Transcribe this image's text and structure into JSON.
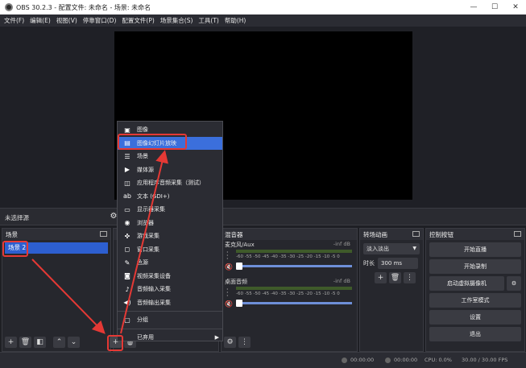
{
  "window": {
    "title": "OBS 30.2.3 - 配置文件: 未命名 - 场景: 未命名",
    "minimize": "—",
    "maximize": "☐",
    "close": "✕"
  },
  "menubar": [
    "文件(F)",
    "编辑(E)",
    "视图(V)",
    "停靠窗口(D)",
    "配置文件(P)",
    "场景集合(S)",
    "工具(T)",
    "帮助(H)"
  ],
  "sourcebar": {
    "no_source": "未选择源"
  },
  "scenes": {
    "title": "场景",
    "items": [
      "场景 2"
    ]
  },
  "sources": {
    "title": "来"
  },
  "mixer": {
    "title": "混音器",
    "channels": [
      {
        "name": "麦克风/Aux",
        "db": "-inf dB"
      },
      {
        "name": "桌面音频",
        "db": "-inf dB"
      }
    ],
    "ticks": "-60 -55 -50 -45 -40 -35 -30 -25 -20 -15 -10 -5 0"
  },
  "transitions": {
    "title": "转场动画",
    "type": "淡入淡出",
    "duration_label": "时长",
    "duration_value": "300 ms"
  },
  "controls": {
    "title": "控制按钮",
    "buttons": [
      "开始直播",
      "开始录制",
      "启动虚拟摄像机",
      "工作室模式",
      "设置",
      "退出"
    ]
  },
  "context_menu": {
    "items": [
      {
        "label": "图像",
        "icon": "image-icon"
      },
      {
        "label": "图像幻灯片放映",
        "icon": "slideshow-icon"
      },
      {
        "label": "场景",
        "icon": "list-icon"
      },
      {
        "label": "媒体源",
        "icon": "play-icon"
      },
      {
        "label": "应用程序音频采集（测试）",
        "icon": "app-audio-icon"
      },
      {
        "label": "文本 (GDI+)",
        "icon": "text-icon"
      },
      {
        "label": "显示器采集",
        "icon": "monitor-icon"
      },
      {
        "label": "浏览器",
        "icon": "globe-icon"
      },
      {
        "label": "游戏采集",
        "icon": "gamepad-icon"
      },
      {
        "label": "窗口采集",
        "icon": "window-icon"
      },
      {
        "label": "色源",
        "icon": "brush-icon"
      },
      {
        "label": "视频采集设备",
        "icon": "camera-icon"
      },
      {
        "label": "音频输入采集",
        "icon": "mic-icon"
      },
      {
        "label": "音频输出采集",
        "icon": "speaker-icon"
      }
    ],
    "group": "分组",
    "deprecated": "已弃用"
  },
  "status": {
    "rec_time": "00:00:00",
    "stream_time": "00:00:00",
    "cpu": "CPU: 0.0%",
    "fps": "30.00 / 30.00 FPS"
  }
}
